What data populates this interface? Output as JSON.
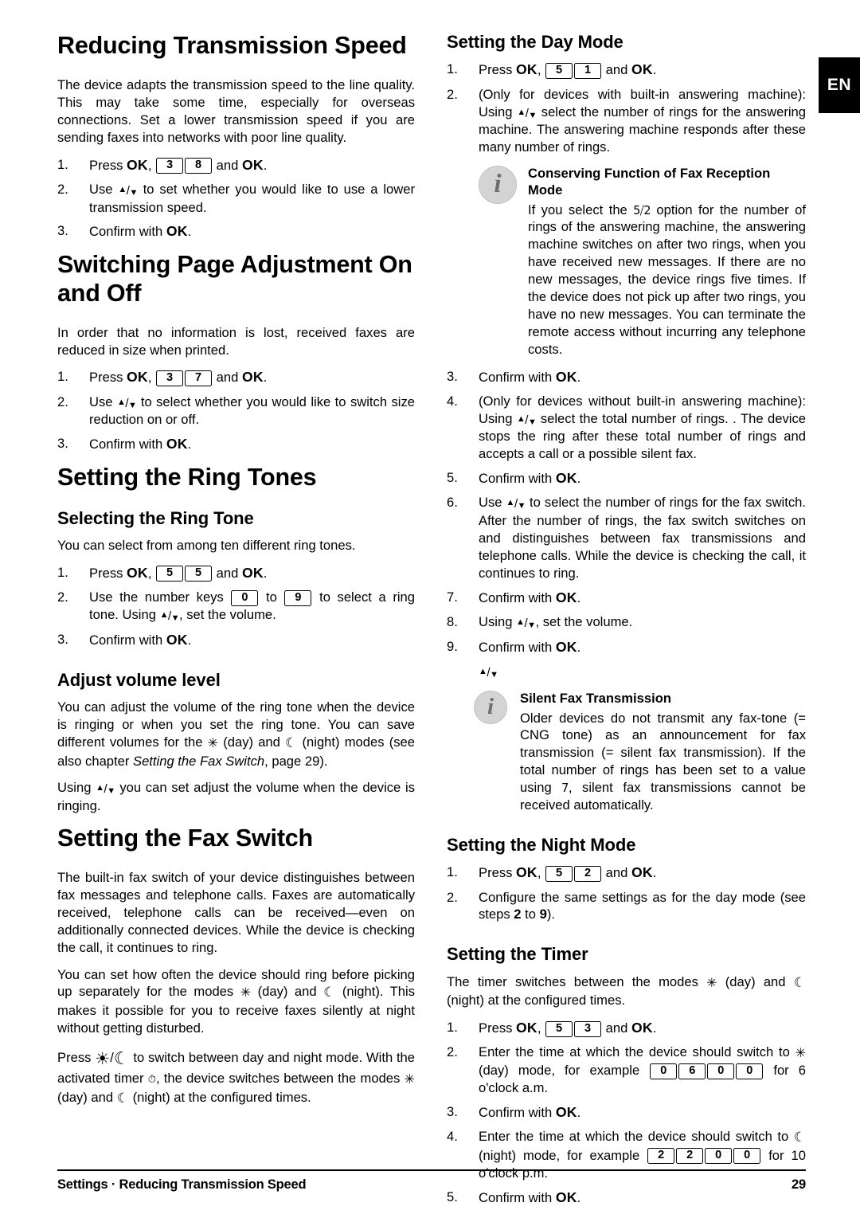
{
  "language_tab": "EN",
  "left_column": {
    "section1": {
      "heading": "Reducing Transmission Speed",
      "intro": "The device adapts the transmission speed to the line quality. This may take some time, especially for overseas connections. Set a lower transmission speed if you are sending faxes into networks with poor line quality.",
      "steps": [
        {
          "num": "1.",
          "pre": "Press ",
          "ok1": "OK",
          "comma": ", ",
          "keys": [
            "3",
            "8"
          ],
          "mid": " and ",
          "ok2": "OK",
          "post": "."
        },
        {
          "num": "2.",
          "text_before": "Use ",
          "arrows": "up/down",
          "text_after": " to set whether you would like to use a lower transmission speed."
        },
        {
          "num": "3.",
          "text_before": "Confirm with ",
          "ok1": "OK",
          "post": "."
        }
      ]
    },
    "section2": {
      "heading": "Switching Page Adjustment On and Off",
      "intro": "In order that no information is lost, received faxes are reduced in size when printed.",
      "steps": [
        {
          "num": "1.",
          "pre": "Press ",
          "ok1": "OK",
          "comma": ", ",
          "keys": [
            "3",
            "7"
          ],
          "mid": " and ",
          "ok2": "OK",
          "post": "."
        },
        {
          "num": "2.",
          "text_before": "Use ",
          "arrows": "up/down",
          "text_after": " to select whether you would like to switch size reduction on or off."
        },
        {
          "num": "3.",
          "text_before": "Confirm with ",
          "ok1": "OK",
          "post": "."
        }
      ]
    },
    "section3": {
      "heading": "Setting the Ring Tones",
      "sub1": {
        "heading": "Selecting the Ring Tone",
        "intro": "You can select from among ten different ring tones.",
        "steps": [
          {
            "num": "1.",
            "pre": "Press ",
            "ok1": "OK",
            "comma": ", ",
            "keys": [
              "5",
              "5"
            ],
            "mid": " and ",
            "ok2": "OK",
            "post": "."
          },
          {
            "num": "2.",
            "part1": "Use the number keys ",
            "key_a": "0",
            "part2": " to ",
            "key_b": "9",
            "part3": " to select a ring tone. Using ",
            "arrows": "up/down",
            "part4": ", set the volume."
          },
          {
            "num": "3.",
            "text_before": "Confirm with ",
            "ok1": "OK",
            "post": "."
          }
        ]
      },
      "sub2": {
        "heading": "Adjust volume level",
        "para1_a": "You can adjust the volume of the ring tone when the device is ringing or when you set the ring tone. You can save different volumes for the ",
        "para1_day": " (day) and ",
        "para1_night": " (night) modes (see also chapter ",
        "para1_italic": "Setting the Fax Switch",
        "para1_end": ", page 29).",
        "para2_a": "Using ",
        "para2_b": " you can set adjust the volume when the device is ringing."
      }
    },
    "section4": {
      "heading": "Setting the Fax Switch",
      "para1": "The built-in fax switch of your device distinguishes between fax messages and telephone calls. Faxes are automatically received, telephone calls can be received—even on additionally connected devices. While the device is checking the call, it continues to ring.",
      "para2_a": "You can set how often the device should ring before picking up separately for the modes ",
      "para2_day": " (day) and ",
      "para2_night": " (night). This makes it possible for you to receive faxes silently at night without getting disturbed.",
      "para3_a": "Press ",
      "para3_b": " to switch between day and night mode. With the activated timer ",
      "para3_c": ", the device switches between the modes ",
      "para3_day": " (day) and ",
      "para3_night": " (night) at the configured times."
    }
  },
  "right_column": {
    "section1": {
      "heading": "Setting the Day Mode",
      "steps": [
        {
          "num": "1.",
          "pre": "Press ",
          "ok1": "OK",
          "comma": ", ",
          "keys": [
            "5",
            "1"
          ],
          "mid": " and ",
          "ok2": "OK",
          "post": "."
        },
        {
          "num": "2.",
          "part1": "(Only for devices with built-in answering machine): Using ",
          "arrows": "up/down",
          "part2": " select the number of rings for the answering machine. The answering machine responds after these many number of rings."
        }
      ],
      "callout": {
        "title": "Conserving Function of Fax Reception Mode",
        "text_a": "If you select the ",
        "lcd_value": "5⧸2",
        "text_b": " option for the number of rings of the answering machine, the answering machine switches on after two rings, when you have received new messages. If there are no new messages, the device rings five times. If the device does not pick up after two rings, you have no new messages. You can terminate the remote access without incurring any telephone costs."
      },
      "steps2": [
        {
          "num": "3.",
          "text_before": "Confirm with ",
          "ok1": "OK",
          "post": "."
        },
        {
          "num": "4.",
          "part1": "(Only for devices without built-in answering machine): Using ",
          "arrows": "up/down",
          "part2": " select the total number of rings. . The device stops the ring after these total number of rings and accepts a call or a possible silent fax."
        },
        {
          "num": "5.",
          "text_before": "Confirm with ",
          "ok1": "OK",
          "post": "."
        },
        {
          "num": "6.",
          "part1": "Use ",
          "arrows": "up/down",
          "part2": " to select the number of rings for the fax switch. After the number of rings, the fax switch switches on and distinguishes between fax transmissions and telephone calls. While the device is checking the call, it continues to ring."
        },
        {
          "num": "7.",
          "text_before": "Confirm with ",
          "ok1": "OK",
          "post": "."
        },
        {
          "num": "8.",
          "part1": "Using ",
          "arrows": "up/down",
          "part2": ", set the volume."
        },
        {
          "num": "9.",
          "text_before": "Confirm with ",
          "ok1": "OK",
          "post": "."
        }
      ],
      "callout2": {
        "title": "Silent Fax Transmission",
        "text_a": "Older devices do not transmit any fax-tone (= CNG tone) as an announcement for fax transmission (= silent fax transmission). If the total number of rings has been set to a value using ",
        "lcd_value": "7",
        "text_b": ", silent fax transmissions cannot be received automatically."
      }
    },
    "section2": {
      "heading": "Setting the Night Mode",
      "steps": [
        {
          "num": "1.",
          "pre": "Press ",
          "ok1": "OK",
          "comma": ", ",
          "keys": [
            "5",
            "2"
          ],
          "mid": " and ",
          "ok2": "OK",
          "post": "."
        },
        {
          "num": "2.",
          "part1": "Configure the same settings as for the day mode (see steps ",
          "b1": "2",
          "part2": " to ",
          "b2": "9",
          "part3": ")."
        }
      ]
    },
    "section3": {
      "heading": "Setting the Timer",
      "intro_a": "The timer switches between the modes ",
      "intro_day": " (day) and ",
      "intro_night": " (night) at the configured times.",
      "steps": [
        {
          "num": "1.",
          "pre": "Press ",
          "ok1": "OK",
          "comma": ", ",
          "keys": [
            "5",
            "3"
          ],
          "mid": " and ",
          "ok2": "OK",
          "post": "."
        },
        {
          "num": "2.",
          "part1": "Enter the time at which the device should switch to ",
          "part_day": " (day) mode, for example ",
          "keys": [
            "0",
            "6",
            "0",
            "0"
          ],
          "part2": " for 6 o'clock a.m."
        },
        {
          "num": "3.",
          "text_before": "Confirm with ",
          "ok1": "OK",
          "post": "."
        },
        {
          "num": "4.",
          "part1": "Enter the time at which the device should switch to ",
          "part_night": " (night) mode, for example ",
          "keys": [
            "2",
            "2",
            "0",
            "0"
          ],
          "part2": " for 10 o'clock p.m."
        },
        {
          "num": "5.",
          "text_before": "Confirm with ",
          "ok1": "OK",
          "post": "."
        }
      ]
    }
  },
  "footer": {
    "breadcrumb": "Settings · Reducing Transmission Speed",
    "page_number": "29"
  },
  "symbols": {
    "day": "✳",
    "night": "☾",
    "sun_big": "☀",
    "moon_big": "☾",
    "timer": "⏱",
    "arrow_up": "▲",
    "arrow_down": "▼",
    "slash": "/"
  }
}
